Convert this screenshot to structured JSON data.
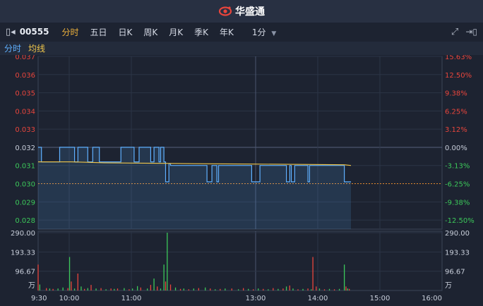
{
  "app": {
    "brand": "华盛通"
  },
  "toolbar": {
    "stock_code": "00555",
    "tabs": [
      "分时",
      "五日",
      "日K",
      "周K",
      "月K",
      "季K",
      "年K"
    ],
    "interval": "1分"
  },
  "indicators": {
    "line1": "分时",
    "line2": "均线"
  },
  "colors": {
    "up": "#e8453c",
    "down": "#3cc85a",
    "price": "#5fb0ff",
    "avg": "#f0c64a",
    "active": "#f0b33c"
  },
  "chart_data": {
    "type": "line",
    "price_axis": {
      "left_ticks": [
        "0.037",
        "0.036",
        "0.035",
        "0.034",
        "0.033",
        "0.032",
        "0.031",
        "0.030",
        "0.029",
        "0.028"
      ],
      "right_ticks": [
        "15.63%",
        "12.50%",
        "9.38%",
        "6.25%",
        "3.12%",
        "0.00%",
        "-3.13%",
        "-6.25%",
        "-9.38%",
        "-12.50%"
      ],
      "ylim": [
        0.0275,
        0.037
      ],
      "prev_close": 0.032,
      "current": 0.03
    },
    "volume_axis": {
      "left_ticks": [
        "290.00",
        "193.33",
        "96.67",
        "万"
      ],
      "right_ticks": [
        "290.00",
        "193.33",
        "96.67",
        "万"
      ],
      "max": 290
    },
    "time_axis": {
      "ticks": [
        "9:30",
        "10:00",
        "11:00",
        "13:00",
        "14:00",
        "15:00",
        "16:00"
      ]
    },
    "series": [
      {
        "values": [
          [
            0,
            0.032
          ],
          [
            2,
            0.032
          ],
          [
            2,
            0.0312
          ],
          [
            13,
            0.0312
          ],
          [
            13,
            0.032
          ],
          [
            22,
            0.032
          ],
          [
            22,
            0.0312
          ],
          [
            24,
            0.0312
          ],
          [
            24,
            0.032
          ],
          [
            30,
            0.032
          ],
          [
            30,
            0.0312
          ],
          [
            33,
            0.0312
          ],
          [
            33,
            0.032
          ],
          [
            37,
            0.032
          ],
          [
            37,
            0.0312
          ],
          [
            50,
            0.0312
          ],
          [
            50,
            0.032
          ],
          [
            58,
            0.032
          ],
          [
            58,
            0.0312
          ],
          [
            61,
            0.0312
          ],
          [
            61,
            0.032
          ],
          [
            68,
            0.032
          ],
          [
            68,
            0.0312
          ],
          [
            70,
            0.0312
          ],
          [
            70,
            0.032
          ],
          [
            73,
            0.032
          ],
          [
            73,
            0.0312
          ],
          [
            74,
            0.0312
          ],
          [
            74,
            0.032
          ],
          [
            76,
            0.032
          ],
          [
            76,
            0.0312
          ],
          [
            77,
            0.0312
          ],
          [
            77,
            0.0301
          ],
          [
            79,
            0.0301
          ],
          [
            79,
            0.0311
          ],
          [
            80,
            0.0311
          ],
          [
            80,
            0.031
          ],
          [
            102,
            0.031
          ],
          [
            102,
            0.0301
          ],
          [
            105,
            0.0301
          ],
          [
            105,
            0.031
          ],
          [
            108,
            0.031
          ],
          [
            108,
            0.0301
          ],
          [
            109,
            0.0301
          ],
          [
            109,
            0.031
          ],
          [
            129,
            0.031
          ],
          [
            129,
            0.0301
          ],
          [
            134,
            0.0301
          ],
          [
            134,
            0.031
          ],
          [
            150,
            0.031
          ],
          [
            150,
            0.0301
          ],
          [
            152,
            0.0301
          ],
          [
            152,
            0.031
          ],
          [
            153,
            0.031
          ],
          [
            153,
            0.0301
          ],
          [
            155,
            0.0301
          ],
          [
            155,
            0.031
          ],
          [
            163,
            0.031
          ],
          [
            163,
            0.0301
          ],
          [
            164,
            0.0301
          ],
          [
            164,
            0.031
          ],
          [
            185,
            0.031
          ],
          [
            185,
            0.0301
          ],
          [
            189,
            0.0301
          ]
        ]
      },
      {
        "values": [
          [
            0,
            0.0312
          ],
          [
            20,
            0.0312
          ],
          [
            40,
            0.03115
          ],
          [
            70,
            0.03112
          ],
          [
            95,
            0.0311
          ],
          [
            130,
            0.03108
          ],
          [
            160,
            0.03106
          ],
          [
            185,
            0.03104
          ],
          [
            189,
            0.031
          ]
        ]
      }
    ],
    "volume": [
      [
        0,
        130,
        "up"
      ],
      [
        1,
        30,
        "down"
      ],
      [
        5,
        12,
        "up"
      ],
      [
        7,
        10,
        "down"
      ],
      [
        9,
        8,
        "up"
      ],
      [
        12,
        10,
        "down"
      ],
      [
        15,
        15,
        "down"
      ],
      [
        18,
        12,
        "up"
      ],
      [
        19,
        168,
        "down"
      ],
      [
        20,
        45,
        "up"
      ],
      [
        22,
        10,
        "down"
      ],
      [
        24,
        85,
        "up"
      ],
      [
        26,
        20,
        "down"
      ],
      [
        28,
        8,
        "up"
      ],
      [
        30,
        12,
        "down"
      ],
      [
        32,
        28,
        "up"
      ],
      [
        35,
        10,
        "down"
      ],
      [
        38,
        12,
        "up"
      ],
      [
        41,
        6,
        "down"
      ],
      [
        44,
        10,
        "up"
      ],
      [
        46,
        8,
        "down"
      ],
      [
        48,
        10,
        "up"
      ],
      [
        52,
        12,
        "down"
      ],
      [
        55,
        6,
        "up"
      ],
      [
        57,
        10,
        "down"
      ],
      [
        60,
        22,
        "down"
      ],
      [
        62,
        15,
        "up"
      ],
      [
        66,
        10,
        "down"
      ],
      [
        68,
        28,
        "up"
      ],
      [
        70,
        60,
        "down"
      ],
      [
        72,
        20,
        "up"
      ],
      [
        74,
        10,
        "down"
      ],
      [
        76,
        130,
        "down"
      ],
      [
        77,
        45,
        "up"
      ],
      [
        78,
        290,
        "down"
      ],
      [
        80,
        30,
        "up"
      ],
      [
        83,
        15,
        "down"
      ],
      [
        86,
        8,
        "up"
      ],
      [
        88,
        10,
        "down"
      ],
      [
        91,
        6,
        "up"
      ],
      [
        94,
        10,
        "down"
      ],
      [
        97,
        12,
        "up"
      ],
      [
        101,
        15,
        "down"
      ],
      [
        104,
        10,
        "up"
      ],
      [
        107,
        6,
        "down"
      ],
      [
        110,
        8,
        "up"
      ],
      [
        113,
        10,
        "down"
      ],
      [
        117,
        10,
        "up"
      ],
      [
        121,
        6,
        "down"
      ],
      [
        124,
        12,
        "up"
      ],
      [
        127,
        8,
        "down"
      ],
      [
        130,
        6,
        "up"
      ],
      [
        133,
        10,
        "down"
      ],
      [
        136,
        8,
        "up"
      ],
      [
        139,
        6,
        "down"
      ],
      [
        142,
        12,
        "up"
      ],
      [
        145,
        8,
        "down"
      ],
      [
        148,
        10,
        "up"
      ],
      [
        150,
        20,
        "down"
      ],
      [
        152,
        25,
        "up"
      ],
      [
        154,
        10,
        "down"
      ],
      [
        157,
        6,
        "up"
      ],
      [
        160,
        8,
        "down"
      ],
      [
        163,
        10,
        "up"
      ],
      [
        165,
        6,
        "down"
      ],
      [
        166,
        168,
        "up"
      ],
      [
        168,
        20,
        "up"
      ],
      [
        170,
        10,
        "down"
      ],
      [
        173,
        6,
        "up"
      ],
      [
        176,
        8,
        "down"
      ],
      [
        179,
        6,
        "up"
      ],
      [
        182,
        8,
        "down"
      ],
      [
        185,
        130,
        "down"
      ],
      [
        186,
        20,
        "up"
      ],
      [
        187,
        10,
        "down"
      ],
      [
        188,
        8,
        "up"
      ]
    ]
  }
}
